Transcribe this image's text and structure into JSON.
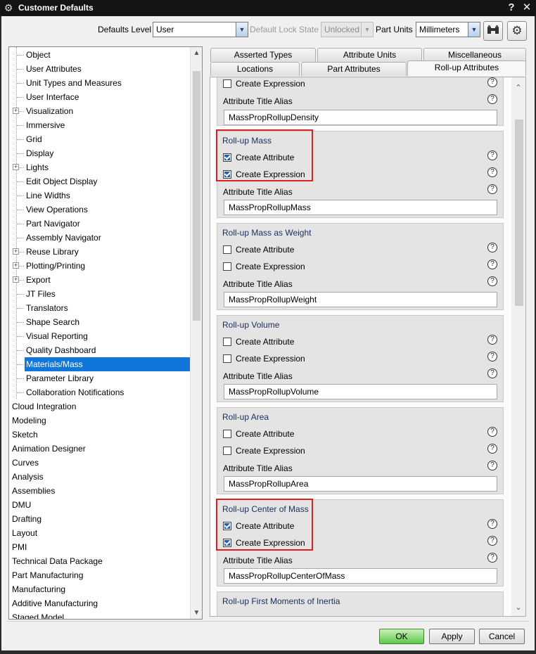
{
  "window": {
    "title": "Customer Defaults",
    "help_glyph": "?",
    "close_glyph": "✕"
  },
  "toolbar": {
    "defaults_level_label": "Defaults Level",
    "defaults_level_value": "User",
    "lock_state_label": "Default Lock State",
    "lock_state_value": "Unlocked",
    "part_units_label": "Part Units",
    "part_units_value": "Millimeters"
  },
  "tree": {
    "children": [
      {
        "label": "Object",
        "expander": false
      },
      {
        "label": "User Attributes",
        "expander": false
      },
      {
        "label": "Unit Types and Measures",
        "expander": false
      },
      {
        "label": "User Interface",
        "expander": false
      },
      {
        "label": "Visualization",
        "expander": true
      },
      {
        "label": "Immersive",
        "expander": false
      },
      {
        "label": "Grid",
        "expander": false
      },
      {
        "label": "Display",
        "expander": false
      },
      {
        "label": "Lights",
        "expander": true
      },
      {
        "label": "Edit Object Display",
        "expander": false
      },
      {
        "label": "Line Widths",
        "expander": false
      },
      {
        "label": "View Operations",
        "expander": false
      },
      {
        "label": "Part Navigator",
        "expander": false
      },
      {
        "label": "Assembly Navigator",
        "expander": false
      },
      {
        "label": "Reuse Library",
        "expander": true
      },
      {
        "label": "Plotting/Printing",
        "expander": true
      },
      {
        "label": "Export",
        "expander": true
      },
      {
        "label": "JT Files",
        "expander": false
      },
      {
        "label": "Translators",
        "expander": false
      },
      {
        "label": "Shape Search",
        "expander": false
      },
      {
        "label": "Visual Reporting",
        "expander": false
      },
      {
        "label": "Quality Dashboard",
        "expander": false
      },
      {
        "label": "Materials/Mass",
        "expander": false,
        "selected": true
      },
      {
        "label": "Parameter Library",
        "expander": false
      },
      {
        "label": "Collaboration Notifications",
        "expander": false
      }
    ],
    "roots": [
      "Cloud Integration",
      "Modeling",
      "Sketch",
      "Animation Designer",
      "Curves",
      "Analysis",
      "Assemblies",
      "DMU",
      "Drafting",
      "Layout",
      "PMI",
      "Technical Data Package",
      "Part Manufacturing",
      "Manufacturing",
      "Additive Manufacturing",
      "Staged Model"
    ]
  },
  "tabs": {
    "row1": [
      "Asserted Types",
      "Attribute Units",
      "Miscellaneous"
    ],
    "row2": [
      "Locations",
      "Part Attributes",
      "Roll-up Attributes"
    ],
    "active": "Roll-up Attributes"
  },
  "panel": {
    "top_partial": {
      "create_expression": "Create Expression",
      "alias_label": "Attribute Title Alias",
      "alias_value": "MassPropRollupDensity"
    },
    "groups": [
      {
        "title": "Roll-up Mass",
        "create_attribute": "Create Attribute",
        "create_attribute_checked": true,
        "create_expression": "Create Expression",
        "create_expression_checked": true,
        "alias_label": "Attribute Title Alias",
        "alias_value": "MassPropRollupMass"
      },
      {
        "title": "Roll-up Mass as Weight",
        "create_attribute": "Create Attribute",
        "create_attribute_checked": false,
        "create_expression": "Create Expression",
        "create_expression_checked": false,
        "alias_label": "Attribute Title Alias",
        "alias_value": "MassPropRollupWeight"
      },
      {
        "title": "Roll-up Volume",
        "create_attribute": "Create Attribute",
        "create_attribute_checked": false,
        "create_expression": "Create Expression",
        "create_expression_checked": false,
        "alias_label": "Attribute Title Alias",
        "alias_value": "MassPropRollupVolume"
      },
      {
        "title": "Roll-up Area",
        "create_attribute": "Create Attribute",
        "create_attribute_checked": false,
        "create_expression": "Create Expression",
        "create_expression_checked": false,
        "alias_label": "Attribute Title Alias",
        "alias_value": "MassPropRollupArea"
      },
      {
        "title": "Roll-up Center of Mass",
        "create_attribute": "Create Attribute",
        "create_attribute_checked": true,
        "create_expression": "Create Expression",
        "create_expression_checked": true,
        "alias_label": "Attribute Title Alias",
        "alias_value": "MassPropRollupCenterOfMass"
      }
    ],
    "bottom_partial_title": "Roll-up First Moments of Inertia"
  },
  "buttons": {
    "ok": "OK",
    "apply": "Apply",
    "cancel": "Cancel"
  },
  "colors": {
    "selection": "#1176d9",
    "highlight_box": "#e02020",
    "ok_button": "#5fc84a",
    "group_title": "#1b2d5e"
  }
}
